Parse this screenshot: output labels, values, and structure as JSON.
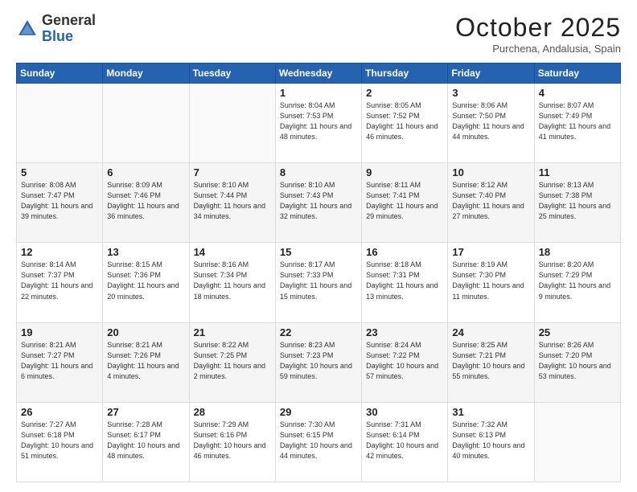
{
  "logo": {
    "general": "General",
    "blue": "Blue"
  },
  "title": "October 2025",
  "location": "Purchena, Andalusia, Spain",
  "days_of_week": [
    "Sunday",
    "Monday",
    "Tuesday",
    "Wednesday",
    "Thursday",
    "Friday",
    "Saturday"
  ],
  "weeks": [
    [
      {
        "day": "",
        "sunrise": "",
        "sunset": "",
        "daylight": ""
      },
      {
        "day": "",
        "sunrise": "",
        "sunset": "",
        "daylight": ""
      },
      {
        "day": "",
        "sunrise": "",
        "sunset": "",
        "daylight": ""
      },
      {
        "day": "1",
        "sunrise": "8:04 AM",
        "sunset": "7:53 PM",
        "daylight": "11 hours and 48 minutes."
      },
      {
        "day": "2",
        "sunrise": "8:05 AM",
        "sunset": "7:52 PM",
        "daylight": "11 hours and 46 minutes."
      },
      {
        "day": "3",
        "sunrise": "8:06 AM",
        "sunset": "7:50 PM",
        "daylight": "11 hours and 44 minutes."
      },
      {
        "day": "4",
        "sunrise": "8:07 AM",
        "sunset": "7:49 PM",
        "daylight": "11 hours and 41 minutes."
      }
    ],
    [
      {
        "day": "5",
        "sunrise": "8:08 AM",
        "sunset": "7:47 PM",
        "daylight": "11 hours and 39 minutes."
      },
      {
        "day": "6",
        "sunrise": "8:09 AM",
        "sunset": "7:46 PM",
        "daylight": "11 hours and 36 minutes."
      },
      {
        "day": "7",
        "sunrise": "8:10 AM",
        "sunset": "7:44 PM",
        "daylight": "11 hours and 34 minutes."
      },
      {
        "day": "8",
        "sunrise": "8:10 AM",
        "sunset": "7:43 PM",
        "daylight": "11 hours and 32 minutes."
      },
      {
        "day": "9",
        "sunrise": "8:11 AM",
        "sunset": "7:41 PM",
        "daylight": "11 hours and 29 minutes."
      },
      {
        "day": "10",
        "sunrise": "8:12 AM",
        "sunset": "7:40 PM",
        "daylight": "11 hours and 27 minutes."
      },
      {
        "day": "11",
        "sunrise": "8:13 AM",
        "sunset": "7:38 PM",
        "daylight": "11 hours and 25 minutes."
      }
    ],
    [
      {
        "day": "12",
        "sunrise": "8:14 AM",
        "sunset": "7:37 PM",
        "daylight": "11 hours and 22 minutes."
      },
      {
        "day": "13",
        "sunrise": "8:15 AM",
        "sunset": "7:36 PM",
        "daylight": "11 hours and 20 minutes."
      },
      {
        "day": "14",
        "sunrise": "8:16 AM",
        "sunset": "7:34 PM",
        "daylight": "11 hours and 18 minutes."
      },
      {
        "day": "15",
        "sunrise": "8:17 AM",
        "sunset": "7:33 PM",
        "daylight": "11 hours and 15 minutes."
      },
      {
        "day": "16",
        "sunrise": "8:18 AM",
        "sunset": "7:31 PM",
        "daylight": "11 hours and 13 minutes."
      },
      {
        "day": "17",
        "sunrise": "8:19 AM",
        "sunset": "7:30 PM",
        "daylight": "11 hours and 11 minutes."
      },
      {
        "day": "18",
        "sunrise": "8:20 AM",
        "sunset": "7:29 PM",
        "daylight": "11 hours and 9 minutes."
      }
    ],
    [
      {
        "day": "19",
        "sunrise": "8:21 AM",
        "sunset": "7:27 PM",
        "daylight": "11 hours and 6 minutes."
      },
      {
        "day": "20",
        "sunrise": "8:21 AM",
        "sunset": "7:26 PM",
        "daylight": "11 hours and 4 minutes."
      },
      {
        "day": "21",
        "sunrise": "8:22 AM",
        "sunset": "7:25 PM",
        "daylight": "11 hours and 2 minutes."
      },
      {
        "day": "22",
        "sunrise": "8:23 AM",
        "sunset": "7:23 PM",
        "daylight": "10 hours and 59 minutes."
      },
      {
        "day": "23",
        "sunrise": "8:24 AM",
        "sunset": "7:22 PM",
        "daylight": "10 hours and 57 minutes."
      },
      {
        "day": "24",
        "sunrise": "8:25 AM",
        "sunset": "7:21 PM",
        "daylight": "10 hours and 55 minutes."
      },
      {
        "day": "25",
        "sunrise": "8:26 AM",
        "sunset": "7:20 PM",
        "daylight": "10 hours and 53 minutes."
      }
    ],
    [
      {
        "day": "26",
        "sunrise": "7:27 AM",
        "sunset": "6:18 PM",
        "daylight": "10 hours and 51 minutes."
      },
      {
        "day": "27",
        "sunrise": "7:28 AM",
        "sunset": "6:17 PM",
        "daylight": "10 hours and 48 minutes."
      },
      {
        "day": "28",
        "sunrise": "7:29 AM",
        "sunset": "6:16 PM",
        "daylight": "10 hours and 46 minutes."
      },
      {
        "day": "29",
        "sunrise": "7:30 AM",
        "sunset": "6:15 PM",
        "daylight": "10 hours and 44 minutes."
      },
      {
        "day": "30",
        "sunrise": "7:31 AM",
        "sunset": "6:14 PM",
        "daylight": "10 hours and 42 minutes."
      },
      {
        "day": "31",
        "sunrise": "7:32 AM",
        "sunset": "6:13 PM",
        "daylight": "10 hours and 40 minutes."
      },
      {
        "day": "",
        "sunrise": "",
        "sunset": "",
        "daylight": ""
      }
    ]
  ]
}
